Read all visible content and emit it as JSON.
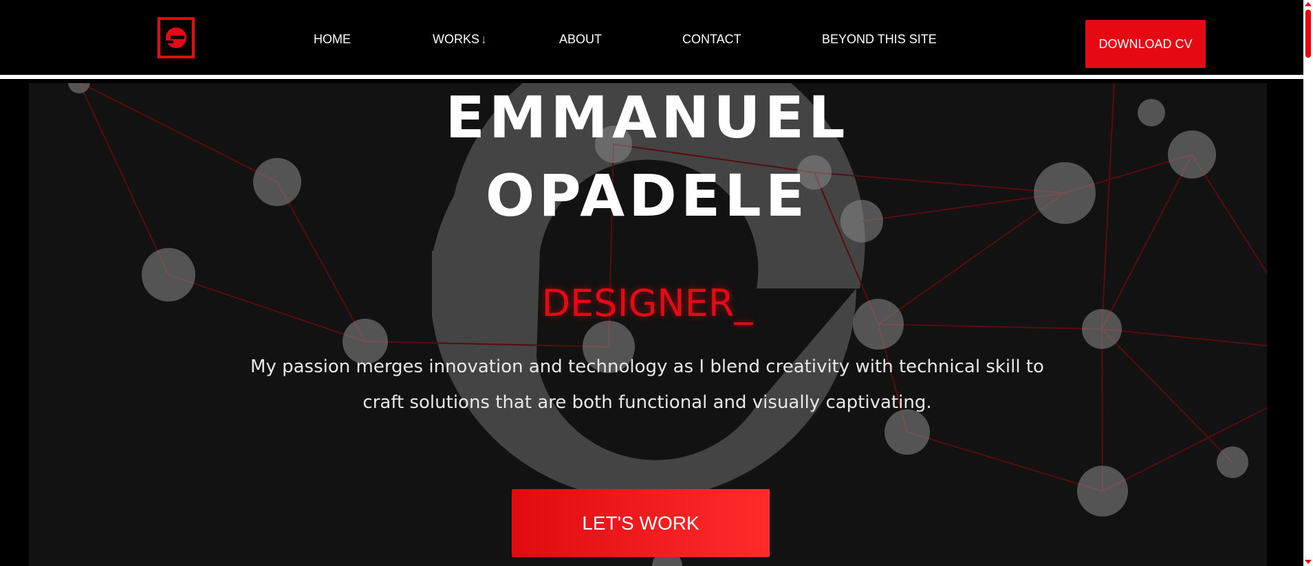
{
  "nav": {
    "logo_name": "ec-logo",
    "items": [
      {
        "label": "HOME"
      },
      {
        "label": "WORKS",
        "icon": "arrow-down-icon"
      },
      {
        "label": "ABOUT"
      },
      {
        "label": "CONTACT"
      },
      {
        "label": "BEYOND THIS SITE"
      }
    ],
    "cta_label": "DOWNLOAD CV"
  },
  "hero": {
    "name_line1": "EMMANUEL",
    "name_line2": "OPADELE",
    "role": "DESIGNER_",
    "tagline": "My passion merges innovation and technology as I blend creativity with technical skill to craft solutions that are both functional and visually captivating.",
    "cta_label": "LET'S WORK"
  },
  "colors": {
    "accent": "#e50914",
    "arrow": "#f0b400",
    "background": "#000000",
    "hero_bg": "#121212"
  }
}
